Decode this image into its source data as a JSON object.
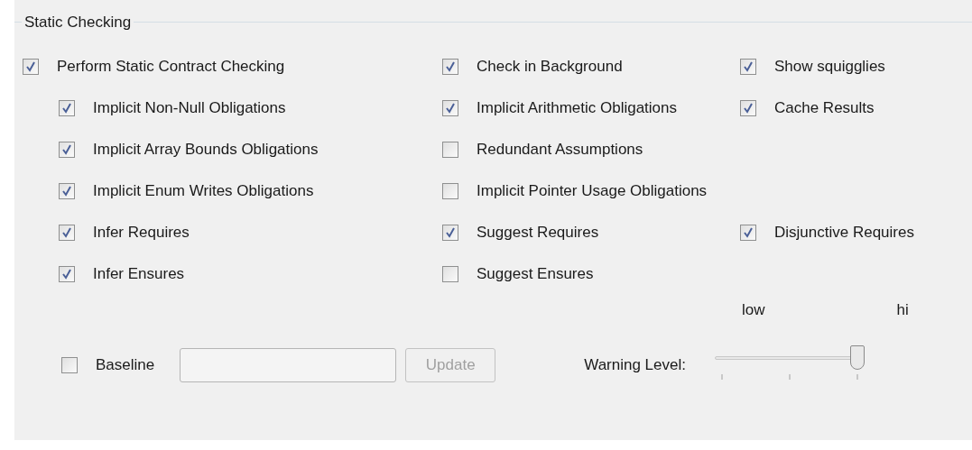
{
  "group": {
    "title": "Static Checking"
  },
  "main_option": {
    "label": "Perform Static Contract Checking",
    "checked": true,
    "children": [
      {
        "label": "Implicit Non-Null Obligations",
        "checked": true
      },
      {
        "label": "Implicit Array Bounds Obligations",
        "checked": true
      },
      {
        "label": "Implicit Enum Writes Obligations",
        "checked": true
      },
      {
        "label": "Infer Requires",
        "checked": true
      },
      {
        "label": "Infer Ensures",
        "checked": true
      }
    ]
  },
  "side_rows": [
    [
      {
        "label": "Check in Background",
        "checked": true
      },
      {
        "label": "Show squigglies",
        "checked": true
      }
    ],
    [
      {
        "label": "Implicit Arithmetic Obligations",
        "checked": true
      },
      {
        "label": "Cache Results",
        "checked": true
      }
    ],
    [
      {
        "label": "Redundant Assumptions",
        "checked": false
      }
    ],
    [
      {
        "label": "Implicit Pointer Usage Obligations",
        "checked": false
      }
    ],
    [
      {
        "label": "Suggest Requires",
        "checked": true
      },
      {
        "label": "Disjunctive Requires",
        "checked": true
      }
    ],
    [
      {
        "label": "Suggest Ensures",
        "checked": false
      }
    ]
  ],
  "baseline": {
    "label": "Baseline",
    "checked": false,
    "button": {
      "label": "Update",
      "disabled": true
    }
  },
  "warning_level": {
    "label": "Warning Level:",
    "low_label": "low",
    "high_label": "hi",
    "level": 1
  }
}
